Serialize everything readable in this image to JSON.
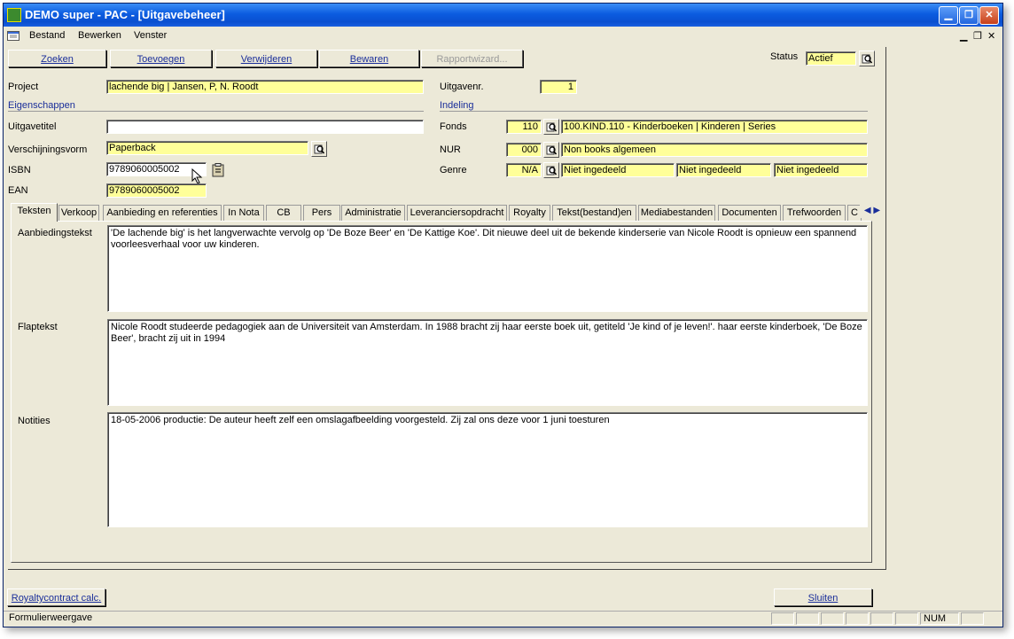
{
  "window": {
    "title": "DEMO super - PAC - [Uitgavebeheer]"
  },
  "menu": [
    "Bestand",
    "Bewerken",
    "Venster"
  ],
  "toolbar": {
    "zoeken": "Zoeken",
    "toevoegen": "Toevoegen",
    "verwijderen": "Verwijderen",
    "bewaren": "Bewaren",
    "rapportwizard": "Rapportwizard..."
  },
  "status": {
    "label": "Status",
    "value": "Actief"
  },
  "project": {
    "label": "Project",
    "value": "lachende big | Jansen, P, N. Roodt"
  },
  "uitgavenr": {
    "label": "Uitgavenr.",
    "value": "1"
  },
  "sections": {
    "eigenschappen": "Eigenschappen",
    "indeling": "Indeling"
  },
  "uitgavetitel": {
    "label": "Uitgavetitel",
    "value": ""
  },
  "verschijningsvorm": {
    "label": "Verschijningsvorm",
    "value": "Paperback"
  },
  "isbn": {
    "label": "ISBN",
    "value": "9789060005002"
  },
  "ean": {
    "label": "EAN",
    "value": "9789060005002"
  },
  "fonds": {
    "label": "Fonds",
    "code": "110",
    "desc": "100.KIND.110 - Kinderboeken | Kinderen | Series"
  },
  "nur": {
    "label": "NUR",
    "code": "000",
    "desc": "Non books algemeen"
  },
  "genre": {
    "label": "Genre",
    "code": "N/A",
    "v1": "Niet ingedeeld",
    "v2": "Niet ingedeeld",
    "v3": "Niet ingedeeld"
  },
  "tabs": [
    "Teksten",
    "Verkoop",
    "Aanbieding en referenties",
    "In Nota",
    "CB",
    "Pers",
    "Administratie",
    "Leveranciersopdracht",
    "Royalty",
    "Tekst(bestand)en",
    "Mediabestanden",
    "Documenten",
    "Trefwoorden",
    "C"
  ],
  "teksten": {
    "aanbieding_label": "Aanbiedingstekst",
    "aanbieding": "'De lachende big' is het langverwachte vervolg op 'De Boze Beer' en 'De Kattige Koe'. Dit nieuwe deel uit de bekende kinderserie van Nicole Roodt is opnieuw een spannend voorleesverhaal voor uw kinderen.",
    "flap_label": "Flaptekst",
    "flap": "Nicole Roodt studeerde pedagogiek aan de Universiteit van Amsterdam. In 1988 bracht zij haar eerste boek uit, getiteld 'Je kind of je leven!'. haar eerste kinderboek, 'De Boze Beer', bracht zij uit in 1994",
    "notities_label": "Notities",
    "notities": "18-05-2006 productie: De auteur heeft zelf een omslagafbeelding voorgesteld. Zij zal ons deze voor 1 juni toesturen"
  },
  "footer": {
    "royalty": "Royaltycontract calc.",
    "sluiten": "Sluiten"
  },
  "statusbar": {
    "mode": "Formulierweergave",
    "num": "NUM"
  },
  "colors": {
    "field_yellow": "#ffff99",
    "titlebar": "#0b5ce0",
    "face": "#ece9d8"
  }
}
